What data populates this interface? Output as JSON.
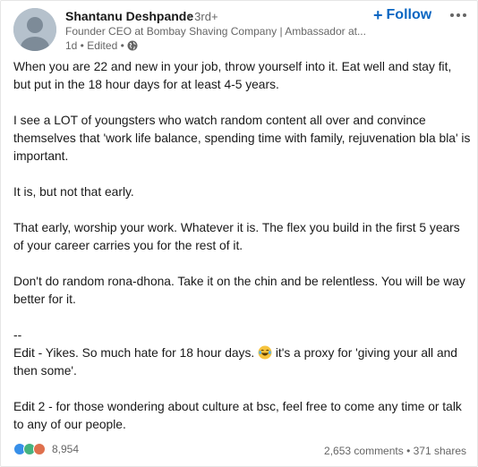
{
  "post": {
    "author": {
      "name": "Shantanu Deshpande",
      "degree": "• 3rd+",
      "headline": "Founder CEO at Bombay Shaving Company | Ambassador at...",
      "meta": "1d • Edited •"
    },
    "follow_label": "Follow",
    "paragraphs": [
      "When you are 22 and new in your job, throw yourself into it. Eat well and stay fit, but put in the 18 hour days for at least 4-5 years.",
      "I see a LOT of youngsters who watch random content all over and convince themselves that 'work life balance, spending time with family, rejuvenation bla bla' is important.",
      "It is, but not that early.",
      "That early, worship your work. Whatever it is. The flex you build in the first 5 years of your career carries you for the rest of it.",
      "Don't do random rona-dhona. Take it on the chin and be relentless. You will be way better for it."
    ],
    "divider": "--",
    "edit1_before": "Edit - Yikes. So much hate for 18 hour days. ",
    "edit1_after": " it's a proxy for 'giving your all and then some'.",
    "edit2": "Edit 2 - for those wondering about culture at bsc, feel free to come any time or talk to any of our people.",
    "reaction_count": "8,954",
    "comments": "2,653 comments",
    "separator": " • ",
    "shares": "371 shares",
    "icons": {
      "globe": "globe-icon",
      "laugh_emoji": "laughing-tears-emoji",
      "like": "like-icon",
      "celebrate": "celebrate-icon",
      "love": "love-icon"
    },
    "colors": {
      "accent": "#0a66c2",
      "muted": "#666666",
      "like": "#378fe9",
      "celebrate": "#44b37f",
      "love": "#df704d"
    }
  }
}
